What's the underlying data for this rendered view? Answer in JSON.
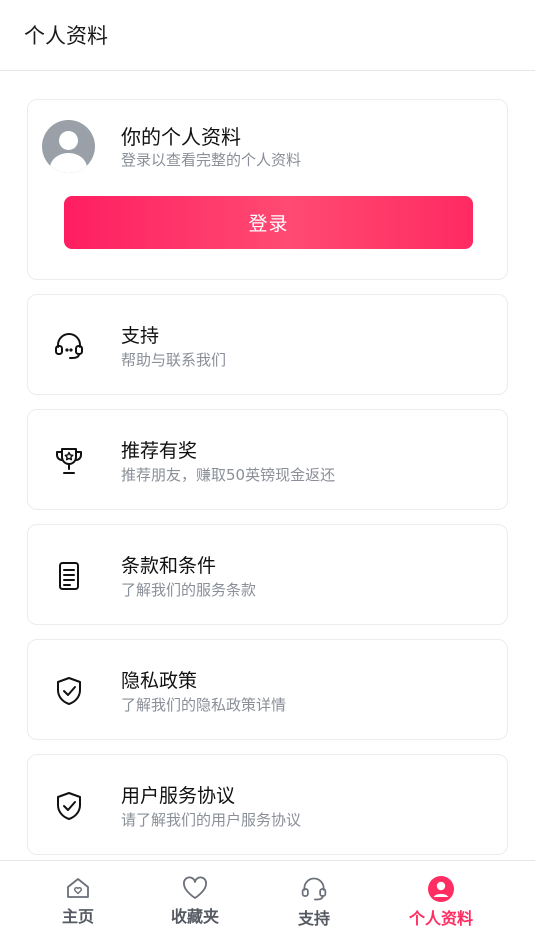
{
  "header": {
    "title": "个人资料"
  },
  "profile": {
    "title": "你的个人资料",
    "subtitle": "登录以查看完整的个人资料",
    "login_label": "登录",
    "avatar_icon": "user-avatar-icon"
  },
  "menu": [
    {
      "title": "支持",
      "subtitle": "帮助与联系我们",
      "icon": "headset-icon"
    },
    {
      "title": "推荐有奖",
      "subtitle": "推荐朋友，赚取50英镑现金返还",
      "icon": "trophy-icon"
    },
    {
      "title": "条款和条件",
      "subtitle": "了解我们的服务条款",
      "icon": "document-icon"
    },
    {
      "title": "隐私政策",
      "subtitle": "了解我们的隐私政策详情",
      "icon": "shield-check-icon"
    },
    {
      "title": "用户服务协议",
      "subtitle": "请了解我们的用户服务协议",
      "icon": "shield-check-icon"
    }
  ],
  "tabbar": {
    "items": [
      {
        "label": "主页",
        "icon": "home-icon",
        "active": false
      },
      {
        "label": "收藏夹",
        "icon": "heart-icon",
        "active": false
      },
      {
        "label": "支持",
        "icon": "headset-icon",
        "active": false
      },
      {
        "label": "个人资料",
        "icon": "user-circle-icon",
        "active": true
      }
    ]
  },
  "colors": {
    "accent": "#ff2d62",
    "text_secondary": "#8a8f98",
    "tab_inactive": "#555a62"
  }
}
